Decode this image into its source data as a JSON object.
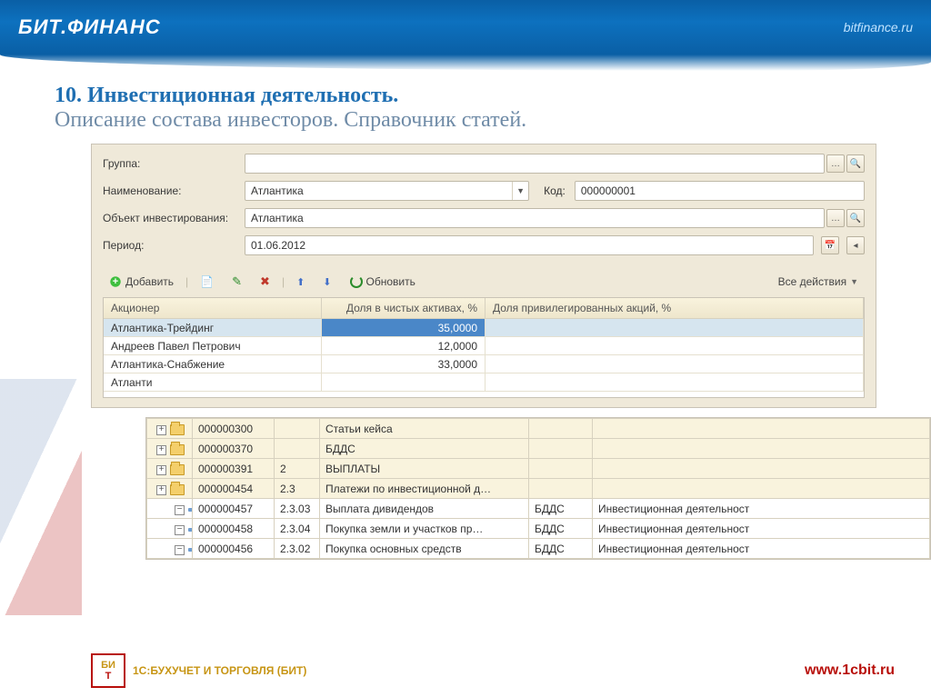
{
  "topbar": {
    "brand": "БИТ.ФИНАНС",
    "site": "bitfinance.ru"
  },
  "heading": {
    "line1": "10. Инвестиционная деятельность.",
    "line2": "Описание состава инвесторов. Справочник статей."
  },
  "form": {
    "labels": {
      "group": "Группа:",
      "name": "Наименование:",
      "object": "Объект инвестирования:",
      "period": "Период:",
      "code": "Код:"
    },
    "values": {
      "group": "",
      "name": "Атлантика",
      "object": "Атлантика",
      "period": "01.06.2012",
      "code": "000000001"
    }
  },
  "toolbar": {
    "add": "Добавить",
    "refresh": "Обновить",
    "all_actions": "Все действия"
  },
  "shareholders": {
    "headers": {
      "name": "Акционер",
      "net_share": "Доля в чистых активах, %",
      "pref_share": "Доля привилегированных акций, %"
    },
    "rows": [
      {
        "name": "Атлантика-Трейдинг",
        "net_share": "35,0000",
        "pref_share": ""
      },
      {
        "name": "Андреев Павел Петрович",
        "net_share": "12,0000",
        "pref_share": ""
      },
      {
        "name": "Атлантика-Снабжение",
        "net_share": "33,0000",
        "pref_share": ""
      }
    ],
    "tail": "Атланти"
  },
  "tree": {
    "rows": [
      {
        "kind": "branch",
        "indent": 1,
        "code": "000000300",
        "num": "",
        "name": "Статьи кейса",
        "type": "",
        "act": ""
      },
      {
        "kind": "branch",
        "indent": 1,
        "code": "000000370",
        "num": "",
        "name": "БДДС",
        "type": "",
        "act": ""
      },
      {
        "kind": "branch",
        "indent": 1,
        "code": "000000391",
        "num": "2",
        "name": "ВЫПЛАТЫ",
        "type": "",
        "act": ""
      },
      {
        "kind": "branch",
        "indent": 1,
        "code": "000000454",
        "num": "2.3",
        "name": "Платежи по инвестиционной д…",
        "type": "",
        "act": ""
      },
      {
        "kind": "leaf",
        "indent": 2,
        "code": "000000457",
        "num": "2.3.03",
        "name": "Выплата дивидендов",
        "type": "БДДС",
        "act": "Инвестиционная деятельност"
      },
      {
        "kind": "leaf",
        "indent": 2,
        "code": "000000458",
        "num": "2.3.04",
        "name": "Покупка земли и участков пр…",
        "type": "БДДС",
        "act": "Инвестиционная деятельност"
      },
      {
        "kind": "leaf",
        "indent": 2,
        "code": "000000456",
        "num": "2.3.02",
        "name": "Покупка основных средств",
        "type": "БДДС",
        "act": "Инвестиционная деятельност"
      }
    ]
  },
  "footer": {
    "logo_mark_top": "БИ",
    "logo_mark_bottom": "Т",
    "logo_text": "1С:БУХУЧЕТ И ТОРГОВЛЯ (БИТ)",
    "url": "www.1cbit.ru"
  }
}
